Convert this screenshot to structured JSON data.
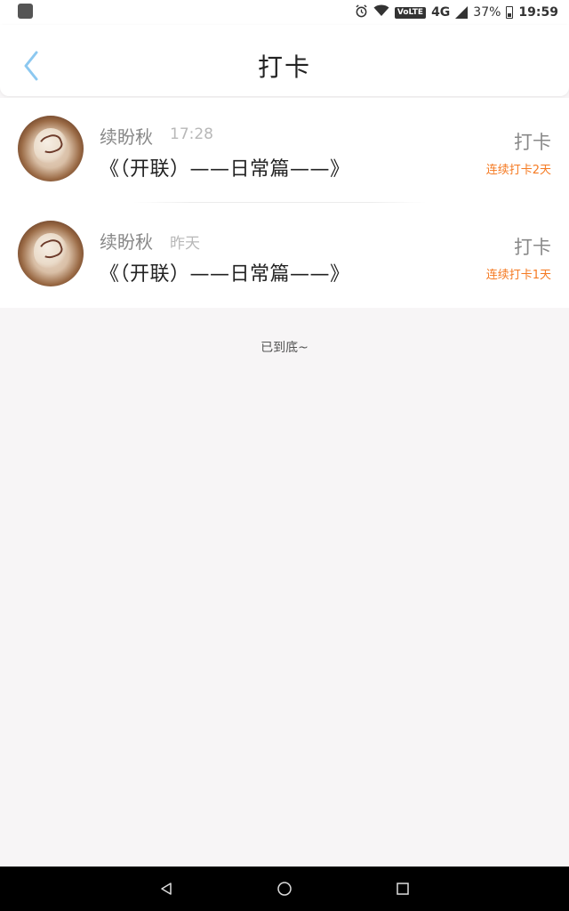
{
  "status_bar": {
    "network": "4G",
    "volte": "VoLTE",
    "battery": "37%",
    "time": "19:59"
  },
  "header": {
    "title": "打卡"
  },
  "records": [
    {
      "name": "续盼秋",
      "time": "17:28",
      "title": "《（开联）——日常篇——》",
      "button": "打卡",
      "streak": "连续打卡2天"
    },
    {
      "name": "续盼秋",
      "time": "昨天",
      "title": "《（开联）——日常篇——》",
      "button": "打卡",
      "streak": "连续打卡1天"
    }
  ],
  "footer": {
    "end_text": "已到底~"
  },
  "colors": {
    "accent_orange": "#f57a22",
    "back_arrow": "#8cc8f0",
    "background": "#f7f5f6"
  },
  "icons": {
    "back": "chevron-left-icon",
    "alarm": "alarm-icon",
    "wifi": "wifi-icon",
    "signal": "signal-icon",
    "battery": "battery-icon",
    "nav_back": "triangle-back-icon",
    "nav_home": "circle-home-icon",
    "nav_recents": "square-recents-icon"
  }
}
